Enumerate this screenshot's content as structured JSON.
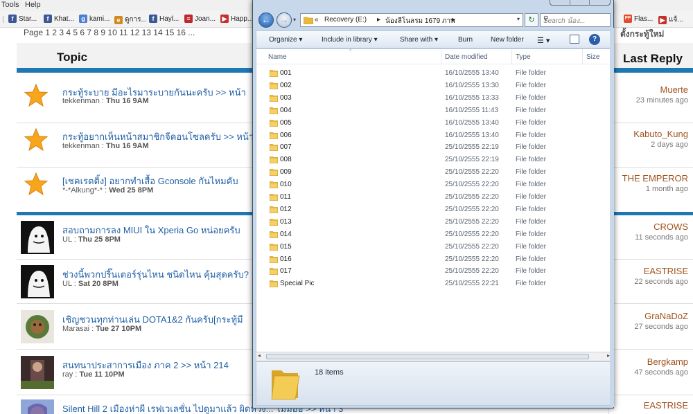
{
  "browser": {
    "menu": [
      "Tools",
      "Help"
    ],
    "bookmarks": [
      {
        "label": "Star...",
        "color": "#3b5998",
        "glyph": "f",
        "icon": "facebook-icon"
      },
      {
        "label": "Khat...",
        "color": "#3b5998",
        "glyph": "f",
        "icon": "facebook-icon"
      },
      {
        "label": "kami...",
        "color": "#4a7fd4",
        "glyph": "g",
        "icon": "google-icon"
      },
      {
        "label": "ดูการ...",
        "color": "#d28a1c",
        "glyph": "e",
        "icon": "page-icon"
      },
      {
        "label": "Hayl...",
        "color": "#3b5998",
        "glyph": "f",
        "icon": "facebook-icon"
      },
      {
        "label": "Joan...",
        "color": "#c0262d",
        "glyph": "≡",
        "icon": "bar-icon"
      },
      {
        "label": "Happ...",
        "color": "#c4302b",
        "glyph": "▶",
        "icon": "youtube-icon"
      },
      {
        "label": "Flas...",
        "color": "#e44c2e",
        "glyph": "FF",
        "icon": "ff-icon"
      },
      {
        "label": "แจ้...",
        "color": "#c4302b",
        "glyph": "▶",
        "icon": "youtube-icon"
      }
    ]
  },
  "forum": {
    "page_label": "Page  1  2  3  4  5  6  7  8  9  10  11  12  13  14  15  16 ...",
    "page_right": "ตั้งกระทู้ใหม่",
    "columns": {
      "topic": "Topic",
      "last_reply": "Last Reply"
    },
    "sticky_topics": [
      {
        "title": "กระทู้ระบาย มีอะไรมาระบายกันนะครับ >> หน้า",
        "author": "tekkenman",
        "date": "Thu 16 9AM",
        "last_user": "Muerte",
        "last_time": "23 minutes ago"
      },
      {
        "title": "กระทู้อยากเห็นหน้าสมาชิกจีคอนโซลครับ >> หน้า",
        "author": "tekkenman",
        "date": "Thu 16 9AM",
        "last_user": "Kabuto_Kung",
        "last_time": "2 days ago"
      },
      {
        "title": "[เชคเรตติ้ง] อยากทำเสื้อ Gconsole กันไหมคับ",
        "author": "*-*Alkung*-*",
        "date": "Wed 25 8PM",
        "last_user": "THE EMPEROR",
        "last_time": "1 month ago"
      }
    ],
    "topics": [
      {
        "title": "สอบถามการลง MIUI ใน Xperia Go หน่อยครับ",
        "author": "UL",
        "date": "Thu 25 8PM",
        "last_user": "CROWS",
        "last_time": "11 seconds ago"
      },
      {
        "title": "ช่วงนี้พวกปริ๊นเตอร์รุ่นไหน ชนิดไหน คุ้มสุดครับ?",
        "author": "UL",
        "date": "Sat 20 8PM",
        "last_user": "EASTRISE",
        "last_time": "22 seconds ago"
      },
      {
        "title": "เชิญชวนทุกท่านเล่น DOTA1&2 กันครับ[กระทู้มี",
        "author": "Marasai",
        "date": "Tue 27 10PM",
        "last_user": "GraNaDoZ",
        "last_time": "27 seconds ago"
      },
      {
        "title": "สนทนาประสาการเมือง ภาค 2 >> หน้า 214",
        "author": "ray",
        "date": "Tue 11 10PM",
        "last_user": "Bergkamp",
        "last_time": "47 seconds ago"
      },
      {
        "title": "Silent Hill 2 เมืองห่าผี เรฟเวเลชั่น ไปดูมาแล้ว ผิดหวัง... ไม่มีออ >> หน้า 3",
        "author": "",
        "date": "",
        "last_user": "EASTRISE",
        "last_time": ""
      }
    ]
  },
  "explorer": {
    "breadcrumb": [
      "«",
      "Recovery (E:)",
      "▸",
      "น้องลีโนลรม 1679 ภาพ",
      "▸"
    ],
    "search_placeholder": "Search น้อง...",
    "toolbar": [
      "Organize ▾",
      "Include in library ▾",
      "Share with ▾",
      "Burn",
      "New folder"
    ],
    "columns": {
      "name": "Name",
      "date": "Date modified",
      "type": "Type",
      "size": "Size"
    },
    "files": [
      {
        "name": "001",
        "date": "16/10/2555 13:40",
        "type": "File folder"
      },
      {
        "name": "002",
        "date": "16/10/2555 13:30",
        "type": "File folder"
      },
      {
        "name": "003",
        "date": "16/10/2555 13:33",
        "type": "File folder"
      },
      {
        "name": "004",
        "date": "16/10/2555 11:43",
        "type": "File folder"
      },
      {
        "name": "005",
        "date": "16/10/2555 13:40",
        "type": "File folder"
      },
      {
        "name": "006",
        "date": "16/10/2555 13:40",
        "type": "File folder"
      },
      {
        "name": "007",
        "date": "25/10/2555 22:19",
        "type": "File folder"
      },
      {
        "name": "008",
        "date": "25/10/2555 22:19",
        "type": "File folder"
      },
      {
        "name": "009",
        "date": "25/10/2555 22:20",
        "type": "File folder"
      },
      {
        "name": "010",
        "date": "25/10/2555 22:20",
        "type": "File folder"
      },
      {
        "name": "011",
        "date": "25/10/2555 22:20",
        "type": "File folder"
      },
      {
        "name": "012",
        "date": "25/10/2555 22:20",
        "type": "File folder"
      },
      {
        "name": "013",
        "date": "25/10/2555 22:20",
        "type": "File folder"
      },
      {
        "name": "014",
        "date": "25/10/2555 22:20",
        "type": "File folder"
      },
      {
        "name": "015",
        "date": "25/10/2555 22:20",
        "type": "File folder"
      },
      {
        "name": "016",
        "date": "25/10/2555 22:20",
        "type": "File folder"
      },
      {
        "name": "017",
        "date": "25/10/2555 22:20",
        "type": "File folder"
      },
      {
        "name": "Special Pic",
        "date": "25/10/2555 22:21",
        "type": "File folder"
      }
    ],
    "item_count": "18 items",
    "folder_color": "#e8b93a"
  }
}
